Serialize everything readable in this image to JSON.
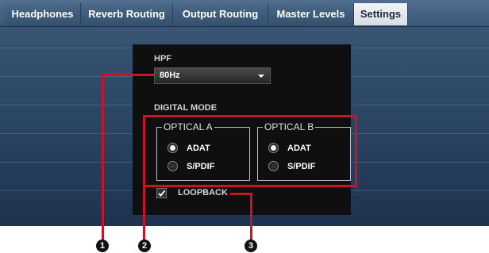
{
  "tabs": [
    {
      "label": "Headphones"
    },
    {
      "label": "Reverb Routing"
    },
    {
      "label": "Output Routing"
    },
    {
      "label": "Master Levels"
    },
    {
      "label": "Settings",
      "active": true
    }
  ],
  "settings": {
    "hpf": {
      "label": "HPF",
      "value": "80Hz"
    },
    "digital_mode": {
      "label": "DIGITAL MODE",
      "optical_a": {
        "title": "OPTICAL A",
        "options": [
          "ADAT",
          "S/PDIF"
        ],
        "selected": "ADAT"
      },
      "optical_b": {
        "title": "OPTICAL B",
        "options": [
          "ADAT",
          "S/PDIF"
        ],
        "selected": "ADAT"
      }
    },
    "loopback": {
      "label": "LOOPBACK",
      "checked": true
    }
  },
  "callouts": [
    "1",
    "2",
    "3"
  ],
  "colors": {
    "callout_red": "#c8142a",
    "panel_bg": "#0f0f10",
    "active_tab": "#e6eaef"
  }
}
